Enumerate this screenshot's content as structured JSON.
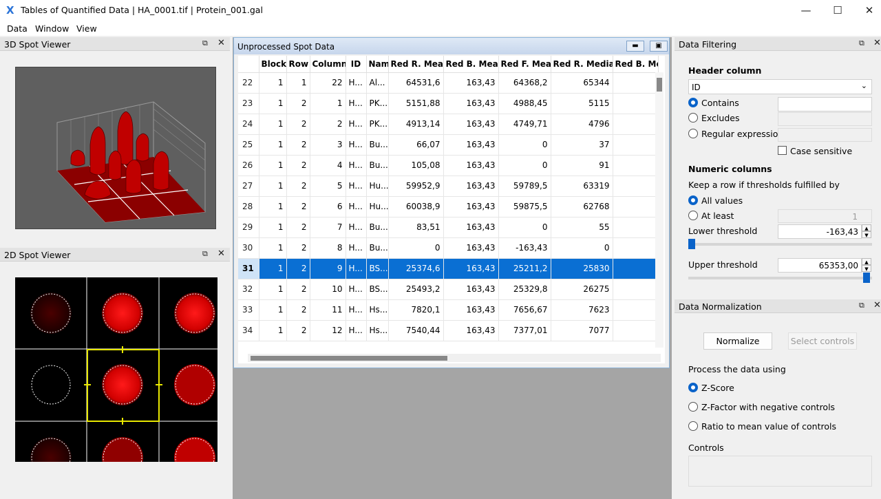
{
  "window": {
    "title": "Tables of Quantified Data | HA_0001.tif | Protein_001.gal",
    "minimize": "—",
    "maximize": "☐",
    "close": "✕"
  },
  "menu": [
    "Data",
    "Window",
    "View"
  ],
  "panels": {
    "spot3d": "3D Spot Viewer",
    "spot2d": "2D Spot Viewer",
    "float": "⧉",
    "close": "✕"
  },
  "table_window": {
    "title": "Unprocessed Spot Data",
    "columns": [
      "Block",
      "Row",
      "Column",
      "ID",
      "Name",
      "Red R. Mean",
      "Red B. Mean",
      "Red F. Mean",
      "Red R. Median",
      "Red B. Me"
    ],
    "rows": [
      {
        "n": "22",
        "c": [
          "1",
          "1",
          "22",
          "H...",
          "Al...",
          "64531,6",
          "163,43",
          "64368,2",
          "65344",
          ""
        ]
      },
      {
        "n": "23",
        "c": [
          "1",
          "2",
          "1",
          "H...",
          "PK...",
          "5151,88",
          "163,43",
          "4988,45",
          "5115",
          ""
        ]
      },
      {
        "n": "24",
        "c": [
          "1",
          "2",
          "2",
          "H...",
          "PK...",
          "4913,14",
          "163,43",
          "4749,71",
          "4796",
          ""
        ]
      },
      {
        "n": "25",
        "c": [
          "1",
          "2",
          "3",
          "H...",
          "Bu...",
          "66,07",
          "163,43",
          "0",
          "37",
          ""
        ]
      },
      {
        "n": "26",
        "c": [
          "1",
          "2",
          "4",
          "H...",
          "Bu...",
          "105,08",
          "163,43",
          "0",
          "91",
          ""
        ]
      },
      {
        "n": "27",
        "c": [
          "1",
          "2",
          "5",
          "H...",
          "Hu...",
          "59952,9",
          "163,43",
          "59789,5",
          "63319",
          ""
        ]
      },
      {
        "n": "28",
        "c": [
          "1",
          "2",
          "6",
          "H...",
          "Hu...",
          "60038,9",
          "163,43",
          "59875,5",
          "62768",
          ""
        ]
      },
      {
        "n": "29",
        "c": [
          "1",
          "2",
          "7",
          "H...",
          "Bu...",
          "83,51",
          "163,43",
          "0",
          "55",
          ""
        ]
      },
      {
        "n": "30",
        "c": [
          "1",
          "2",
          "8",
          "H...",
          "Bu...",
          "0",
          "163,43",
          "-163,43",
          "0",
          ""
        ]
      },
      {
        "n": "31",
        "c": [
          "1",
          "2",
          "9",
          "H...",
          "BS...",
          "25374,6",
          "163,43",
          "25211,2",
          "25830",
          ""
        ],
        "selected": true
      },
      {
        "n": "32",
        "c": [
          "1",
          "2",
          "10",
          "H...",
          "BS...",
          "25493,2",
          "163,43",
          "25329,8",
          "26275",
          ""
        ]
      },
      {
        "n": "33",
        "c": [
          "1",
          "2",
          "11",
          "H...",
          "Hs...",
          "7820,1",
          "163,43",
          "7656,67",
          "7623",
          ""
        ]
      },
      {
        "n": "34",
        "c": [
          "1",
          "2",
          "12",
          "H...",
          "Hs...",
          "7540,44",
          "163,43",
          "7377,01",
          "7077",
          ""
        ]
      }
    ]
  },
  "filtering": {
    "title": "Data Filtering",
    "header_column": "Header column",
    "selected_column": "ID",
    "contains": "Contains",
    "excludes": "Excludes",
    "regex": "Regular expression",
    "case_sensitive": "Case sensitive",
    "numeric_columns": "Numeric columns",
    "keep_row": "Keep a row if thresholds fulfilled by",
    "all_values": "All values",
    "at_least": "At least",
    "at_least_value": "1",
    "lower_threshold": "Lower threshold",
    "lower_value": "-163,43",
    "lower_slider_level": 0.0,
    "upper_threshold": "Upper threshold",
    "upper_value": "65353,00",
    "upper_slider_level": 1.0
  },
  "normalization": {
    "title": "Data Normalization",
    "normalize": "Normalize",
    "select_controls": "Select controls",
    "process_using": "Process the data using",
    "zscore": "Z-Score",
    "zfactor": "Z-Factor with negative controls",
    "ratio": "Ratio to mean value of controls",
    "controls": "Controls"
  },
  "colors": {
    "accent": "#0a63c9",
    "selection": "#0a6fd3",
    "spot_red": "#e00000"
  }
}
